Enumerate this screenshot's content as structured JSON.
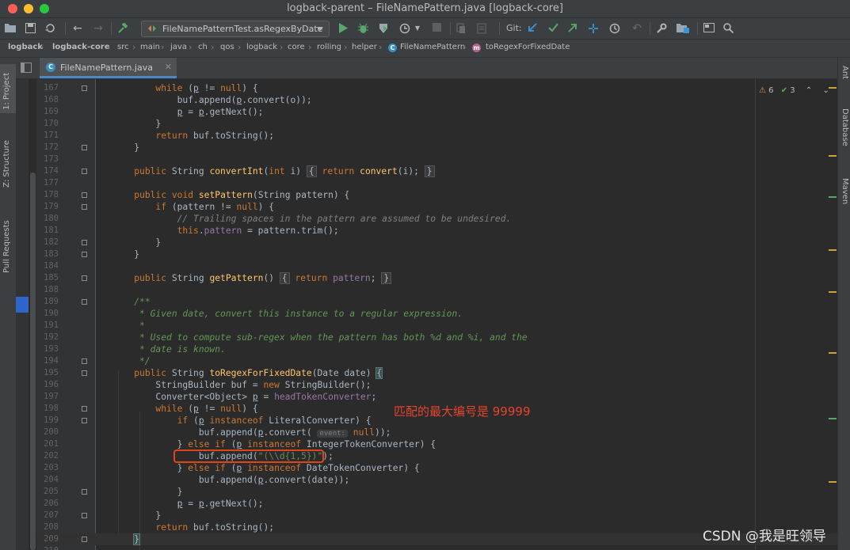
{
  "window": {
    "title": "logback-parent – FileNamePattern.java [logback-core]"
  },
  "toolbar": {
    "run_config": "FileNamePatternTest.asRegexByDate",
    "git_label": "Git:"
  },
  "breadcrumb": [
    "logback",
    "logback-core",
    "src",
    "main",
    "java",
    "ch",
    "qos",
    "logback",
    "core",
    "rolling",
    "helper",
    "FileNamePattern",
    "toRegexForFixedDate"
  ],
  "left_tabs": {
    "project": "1: Project",
    "structure": "Z: Structure",
    "pull_requests": "Pull Requests"
  },
  "right_tabs": {
    "ant": "Ant",
    "database": "Database",
    "maven": "Maven"
  },
  "editor": {
    "tab_label": "FileNamePattern.java",
    "inspections": {
      "warnings": "6",
      "weak_warnings": "3"
    },
    "lines": [
      {
        "n": "167",
        "t": "        while (p != null) {"
      },
      {
        "n": "168",
        "t": "            buf.append(p.convert(o));"
      },
      {
        "n": "169",
        "t": "            p = p.getNext();"
      },
      {
        "n": "170",
        "t": "        }"
      },
      {
        "n": "171",
        "t": "        return buf.toString();"
      },
      {
        "n": "172",
        "t": "    }"
      },
      {
        "n": "173",
        "t": ""
      },
      {
        "n": "174",
        "t": "    public String convertInt(int i) { return convert(i); }"
      },
      {
        "n": "177",
        "t": ""
      },
      {
        "n": "178",
        "t": "    public void setPattern(String pattern) {"
      },
      {
        "n": "179",
        "t": "        if (pattern != null) {"
      },
      {
        "n": "180",
        "t": "            // Trailing spaces in the pattern are assumed to be undesired."
      },
      {
        "n": "181",
        "t": "            this.pattern = pattern.trim();"
      },
      {
        "n": "182",
        "t": "        }"
      },
      {
        "n": "183",
        "t": "    }"
      },
      {
        "n": "184",
        "t": ""
      },
      {
        "n": "185",
        "t": "    public String getPattern() { return pattern; }"
      },
      {
        "n": "188",
        "t": ""
      },
      {
        "n": "189",
        "t": "    /**"
      },
      {
        "n": "190",
        "t": "     * Given date, convert this instance to a regular expression."
      },
      {
        "n": "191",
        "t": "     *"
      },
      {
        "n": "192",
        "t": "     * Used to compute sub-regex when the pattern has both %d and %i, and the"
      },
      {
        "n": "193",
        "t": "     * date is known."
      },
      {
        "n": "194",
        "t": "     */"
      },
      {
        "n": "195",
        "t": "    public String toRegexForFixedDate(Date date) {"
      },
      {
        "n": "196",
        "t": "        StringBuilder buf = new StringBuilder();"
      },
      {
        "n": "197",
        "t": "        Converter<Object> p = headTokenConverter;"
      },
      {
        "n": "198",
        "t": "        while (p != null) {"
      },
      {
        "n": "199",
        "t": "            if (p instanceof LiteralConverter) {"
      },
      {
        "n": "200",
        "t": "                buf.append(p.convert( event: null));"
      },
      {
        "n": "201",
        "t": "            } else if (p instanceof IntegerTokenConverter) {"
      },
      {
        "n": "202",
        "t": "                buf.append(\"(\\\\d{1,5})\");"
      },
      {
        "n": "203",
        "t": "            } else if (p instanceof DateTokenConverter) {"
      },
      {
        "n": "204",
        "t": "                buf.append(p.convert(date));"
      },
      {
        "n": "205",
        "t": "            }"
      },
      {
        "n": "206",
        "t": "            p = p.getNext();"
      },
      {
        "n": "207",
        "t": "        }"
      },
      {
        "n": "208",
        "t": "        return buf.toString();"
      },
      {
        "n": "209",
        "t": "    }"
      },
      {
        "n": "210",
        "t": ""
      }
    ]
  },
  "annotation": {
    "text": "匹配的最大编号是 99999"
  },
  "watermark": "CSDN @我是旺领导",
  "colors": {
    "keyword": "#cc7832",
    "method": "#ffc66d",
    "field": "#9876aa",
    "comment": "#808080",
    "doc": "#629755",
    "string": "#6a8759",
    "annotation": "#e8432b"
  }
}
